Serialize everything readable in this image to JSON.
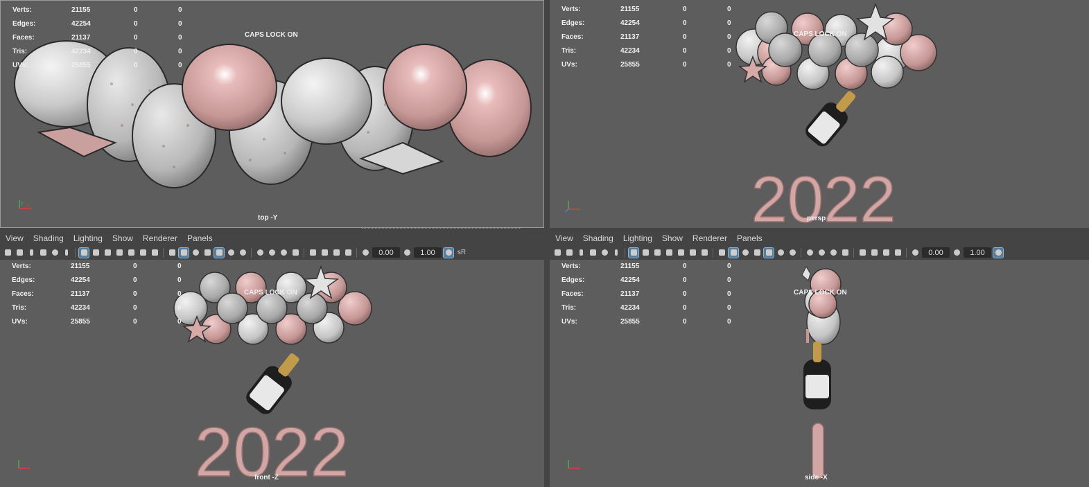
{
  "stats": {
    "rows": [
      {
        "label": "Verts:",
        "v1": "21155",
        "v2": "0",
        "v3": "0"
      },
      {
        "label": "Edges:",
        "v1": "42254",
        "v2": "0",
        "v3": "0"
      },
      {
        "label": "Faces:",
        "v1": "21137",
        "v2": "0",
        "v3": "0"
      },
      {
        "label": "Tris:",
        "v1": "42234",
        "v2": "0",
        "v3": "0"
      },
      {
        "label": "UVs:",
        "v1": "25855",
        "v2": "0",
        "v3": "0"
      }
    ]
  },
  "caps_lock": "CAPS LOCK ON",
  "viewports": {
    "top": {
      "camera": "top -Y"
    },
    "persp": {
      "camera": "persp"
    },
    "front": {
      "camera": "front -Z"
    },
    "side": {
      "camera": "side -X"
    }
  },
  "menu": {
    "view": "View",
    "shading": "Shading",
    "lighting": "Lighting",
    "show": "Show",
    "renderer": "Renderer",
    "panels": "Panels"
  },
  "toolbar": {
    "exposure": "0.00",
    "gamma": "1.00",
    "colorspace": "sR"
  },
  "scene": {
    "year_text": "2022"
  },
  "colors": {
    "pink": "#c9a09e",
    "white_balloon": "#d8d8d8",
    "viewport_bg": "#5d5d5d",
    "toolbar_bg": "#444444",
    "highlight": "#5a7e99"
  },
  "icons": [
    "camera-icon",
    "bookmark-icon",
    "grid-icon",
    "film-gate-icon",
    "wireframe-icon",
    "smooth-shade-icon",
    "lights-icon",
    "isolate-icon"
  ]
}
